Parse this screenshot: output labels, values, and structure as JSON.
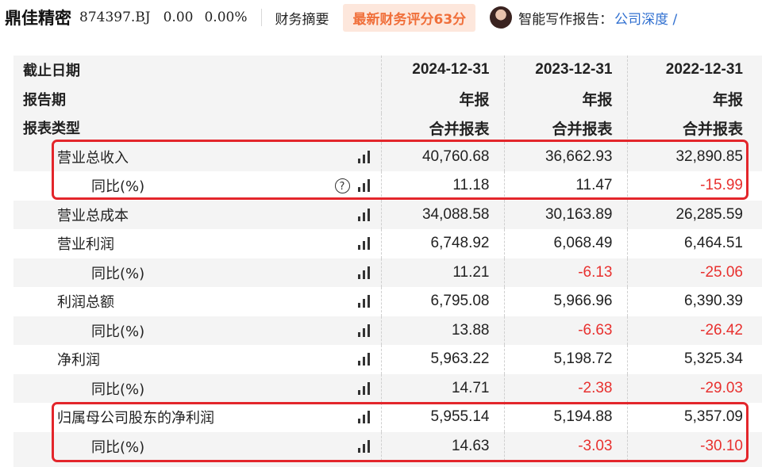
{
  "header": {
    "stock_name": "鼎佳精密",
    "stock_code": "874397.BJ",
    "price": "0.00",
    "change_pct": "0.00%",
    "financial_summary": "财务摘要",
    "latest_score": "最新财务评分63分",
    "smart_report_label": "智能写作报告：",
    "report_link": "公司深度 /"
  },
  "table": {
    "header_rows": [
      {
        "label": "截止日期",
        "values": [
          "2024-12-31",
          "2023-12-31",
          "2022-12-31"
        ]
      },
      {
        "label": "报告期",
        "values": [
          "年报",
          "年报",
          "年报"
        ]
      },
      {
        "label": "报表类型",
        "values": [
          "合并报表",
          "合并报表",
          "合并报表"
        ]
      }
    ],
    "rows": [
      {
        "label": "营业总收入",
        "values": [
          "40,760.68",
          "36,662.93",
          "32,890.85"
        ]
      },
      {
        "label": "同比(%)",
        "values": [
          "11.18",
          "11.47",
          "-15.99"
        ]
      },
      {
        "label": "营业总成本",
        "values": [
          "34,088.58",
          "30,163.89",
          "26,285.59"
        ]
      },
      {
        "label": "营业利润",
        "values": [
          "6,748.92",
          "6,068.49",
          "6,464.51"
        ]
      },
      {
        "label": "同比(%)",
        "values": [
          "11.21",
          "-6.13",
          "-25.06"
        ]
      },
      {
        "label": "利润总额",
        "values": [
          "6,795.08",
          "5,966.96",
          "6,390.39"
        ]
      },
      {
        "label": "同比(%)",
        "values": [
          "13.88",
          "-6.63",
          "-26.42"
        ]
      },
      {
        "label": "净利润",
        "values": [
          "5,963.22",
          "5,198.72",
          "5,325.34"
        ]
      },
      {
        "label": "同比(%)",
        "values": [
          "14.71",
          "-2.38",
          "-29.03"
        ]
      },
      {
        "label": "归属母公司股东的净利润",
        "values": [
          "5,955.14",
          "5,194.88",
          "5,357.09"
        ]
      },
      {
        "label": "同比(%)",
        "values": [
          "14.63",
          "-3.03",
          "-30.10"
        ]
      }
    ]
  },
  "icons": {
    "chart": "bar-chart-icon",
    "help": "question-circle-icon"
  },
  "help_icon_glyph": "?",
  "colors": {
    "negative": "#e8312f",
    "highlight_border": "#e3262b",
    "score_badge_bg": "#fde7dc",
    "score_badge_text": "#f06f3a",
    "link": "#2f6fd0"
  }
}
